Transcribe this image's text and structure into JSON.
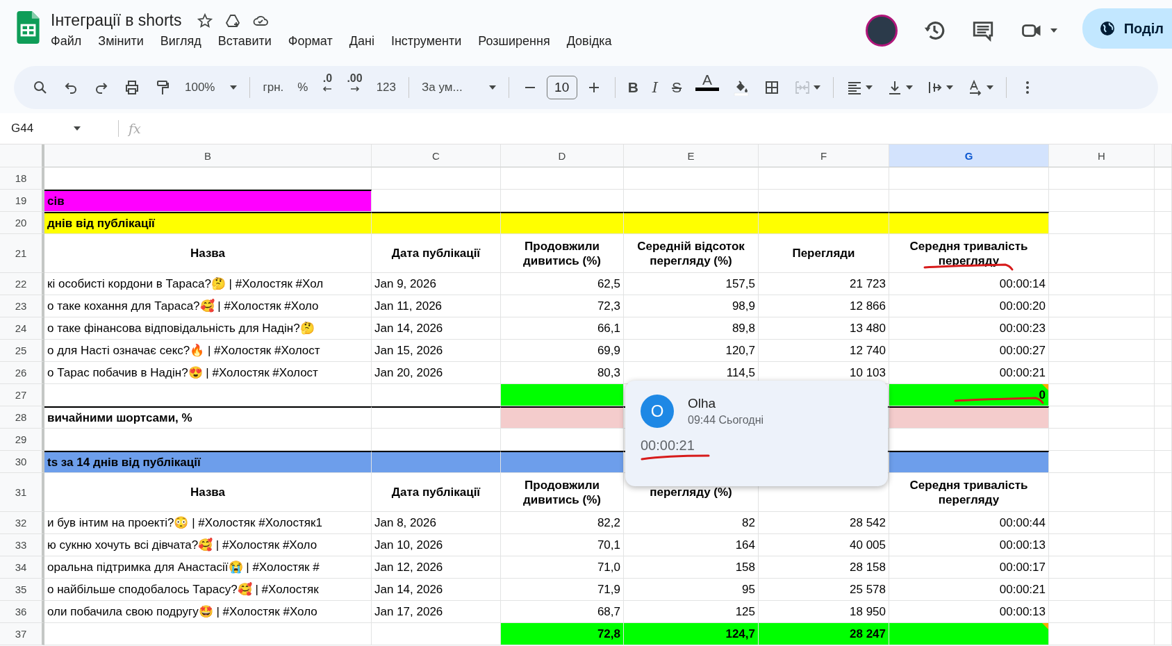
{
  "app": {
    "title": "Інтеграції в shorts",
    "menu": [
      "Файл",
      "Змінити",
      "Вигляд",
      "Вставити",
      "Формат",
      "Дані",
      "Інструменти",
      "Розширення",
      "Довідка"
    ],
    "share_label": "Поділ"
  },
  "toolbar": [
    {
      "kind": "search",
      "disabled": false
    },
    {
      "kind": "undo",
      "disabled": false
    },
    {
      "kind": "redo",
      "disabled": false
    },
    {
      "kind": "print",
      "disabled": false
    },
    {
      "kind": "roller",
      "disabled": false
    },
    {
      "kind": "dropdown",
      "label": "100%"
    },
    {
      "kind": "separator"
    },
    {
      "kind": "label",
      "label": "грн."
    },
    {
      "kind": "label",
      "label": "%"
    },
    {
      "kind": "decdecrease",
      "label": ".0"
    },
    {
      "kind": "decincrease",
      "label": ".00"
    },
    {
      "kind": "label",
      "label": "123"
    },
    {
      "kind": "separator"
    },
    {
      "kind": "dropdown",
      "label": "За ум..."
    },
    {
      "kind": "separator"
    },
    {
      "kind": "minus",
      "disabled": false
    },
    {
      "kind": "field",
      "label": "10"
    },
    {
      "kind": "plus",
      "disabled": false
    },
    {
      "kind": "separator"
    },
    {
      "kind": "bold",
      "label": "B"
    },
    {
      "kind": "italic",
      "label": "I"
    },
    {
      "kind": "strike",
      "label": "S"
    },
    {
      "kind": "textcolor",
      "label": "A"
    },
    {
      "kind": "bucket",
      "disabled": false
    },
    {
      "kind": "borders",
      "disabled": false
    },
    {
      "kind": "merge",
      "disabled": true
    },
    {
      "kind": "separator"
    },
    {
      "kind": "align",
      "disabled": false
    },
    {
      "kind": "valign",
      "disabled": false
    },
    {
      "kind": "wrap",
      "disabled": false
    },
    {
      "kind": "rotate",
      "disabled": false
    },
    {
      "kind": "separator"
    },
    {
      "kind": "more",
      "disabled": false
    }
  ],
  "formula_bar": {
    "name_box": "G44",
    "fx": "fx"
  },
  "columns": [
    {
      "label": "B",
      "selected": false
    },
    {
      "label": "C",
      "selected": false
    },
    {
      "label": "D",
      "selected": false
    },
    {
      "label": "E",
      "selected": false
    },
    {
      "label": "F",
      "selected": false
    },
    {
      "label": "G",
      "selected": true
    },
    {
      "label": "H",
      "selected": false
    }
  ],
  "rows": [
    {
      "number": "18",
      "kind": "data",
      "cells": [
        {},
        {},
        {},
        {},
        {},
        {},
        {}
      ]
    },
    {
      "number": "19",
      "kind": "section",
      "cells": [
        {
          "text": "сів",
          "color": "#ff00ff"
        },
        {},
        {},
        {},
        {},
        {},
        {}
      ]
    },
    {
      "number": "20",
      "kind": "section",
      "cells": [
        {
          "text": "днів від публікації",
          "color": "#ffff00"
        },
        {
          "color": "#ffff00"
        },
        {
          "color": "#ffff00"
        },
        {
          "color": "#ffff00"
        },
        {
          "color": "#ffff00"
        },
        {
          "color": "#ffff00"
        },
        {}
      ]
    },
    {
      "number": "21",
      "kind": "header",
      "cells": [
        {
          "text": "Назва"
        },
        {
          "text": "Дата публікації"
        },
        {
          "text": "Продовжили дивитись (%)"
        },
        {
          "text": "Середній відсоток перегляду (%)"
        },
        {
          "text": "Перегляди"
        },
        {
          "text": "Середня тривалість перегляду",
          "marked": true
        },
        {}
      ]
    },
    {
      "number": "22",
      "kind": "data",
      "cells": [
        {
          "text": "кі особисті кордони в Тараса?🤔 | #Холостяк #Хол"
        },
        {
          "text": "Jan 9, 2026"
        },
        {
          "text": "62,5"
        },
        {
          "text": "157,5"
        },
        {
          "text": "21 723"
        },
        {
          "text": "00:00:14"
        },
        {}
      ]
    },
    {
      "number": "23",
      "kind": "data",
      "cells": [
        {
          "text": "о таке кохання для Тараса?🥰 | #Холостяк #Холо"
        },
        {
          "text": "Jan 11, 2026"
        },
        {
          "text": "72,3"
        },
        {
          "text": "98,9"
        },
        {
          "text": "12 866"
        },
        {
          "text": "00:00:20"
        },
        {}
      ]
    },
    {
      "number": "24",
      "kind": "data",
      "cells": [
        {
          "text": "о таке фінансова відповідальність для Надін?🤔"
        },
        {
          "text": "Jan 14, 2026"
        },
        {
          "text": "66,1"
        },
        {
          "text": "89,8"
        },
        {
          "text": "13 480"
        },
        {
          "text": "00:00:23"
        },
        {}
      ]
    },
    {
      "number": "25",
      "kind": "data",
      "cells": [
        {
          "text": "о для Насті означає секс?🔥 | #Холостяк #Холост"
        },
        {
          "text": "Jan 15, 2026"
        },
        {
          "text": "69,9"
        },
        {
          "text": "120,7"
        },
        {
          "text": "12 740"
        },
        {
          "text": "00:00:27"
        },
        {}
      ]
    },
    {
      "number": "26",
      "kind": "data",
      "cells": [
        {
          "text": "о Тарас побачив в Надін?😍 | #Холостяк #Холост"
        },
        {
          "text": "Jan 20, 2026"
        },
        {
          "text": "80,3"
        },
        {
          "text": "114,5"
        },
        {
          "text": "10 103"
        },
        {
          "text": "00:00:21"
        },
        {}
      ]
    },
    {
      "number": "27",
      "kind": "total",
      "cells": [
        {},
        {},
        {
          "color": "#00ff00"
        },
        {},
        {},
        {
          "text": "0",
          "color": "#00ff00",
          "comment": true,
          "marked": true
        },
        {}
      ]
    },
    {
      "number": "28",
      "kind": "section",
      "cells": [
        {
          "text": "вичайними шортсами, %"
        },
        {},
        {
          "color": "#f4cccc"
        },
        {},
        {},
        {
          "color": "#f4cccc"
        },
        {}
      ]
    },
    {
      "number": "29",
      "kind": "data",
      "cells": [
        {},
        {},
        {},
        {},
        {},
        {},
        {}
      ]
    },
    {
      "number": "30",
      "kind": "section",
      "cells": [
        {
          "text": "ts за 14 днів від публікації",
          "color": "#6d9eeb"
        },
        {
          "color": "#6d9eeb"
        },
        {
          "color": "#6d9eeb"
        },
        {},
        {},
        {
          "color": "#6d9eeb"
        },
        {}
      ]
    },
    {
      "number": "31",
      "kind": "header",
      "cells": [
        {
          "text": "Назва"
        },
        {
          "text": "Дата публікації"
        },
        {
          "text": "Продовжили дивитись (%)"
        },
        {
          "text": "перегляду (%)"
        },
        {},
        {
          "text": "Середня тривалість перегляду"
        },
        {}
      ]
    },
    {
      "number": "32",
      "kind": "data",
      "cells": [
        {
          "text": "и був інтим на проекті?😳 | #Холостяк #Холостяк1"
        },
        {
          "text": "Jan 8, 2026"
        },
        {
          "text": "82,2"
        },
        {
          "text": "82"
        },
        {
          "text": "28 542"
        },
        {
          "text": "00:00:44"
        },
        {}
      ]
    },
    {
      "number": "33",
      "kind": "data",
      "cells": [
        {
          "text": "ю сукню хочуть всі дівчата?🥰 | #Холостяк #Холо"
        },
        {
          "text": "Jan 10, 2026"
        },
        {
          "text": "70,1"
        },
        {
          "text": "164"
        },
        {
          "text": "40 005"
        },
        {
          "text": "00:00:13"
        },
        {}
      ]
    },
    {
      "number": "34",
      "kind": "data",
      "cells": [
        {
          "text": "оральна підтримка для Анастасії😭 | #Холостяк #"
        },
        {
          "text": "Jan 12, 2026"
        },
        {
          "text": "71,0"
        },
        {
          "text": "158"
        },
        {
          "text": "28 158"
        },
        {
          "text": "00:00:17"
        },
        {}
      ]
    },
    {
      "number": "35",
      "kind": "data",
      "cells": [
        {
          "text": "о найбільше сподобалось Тарасу?🥰 | #Холостяк"
        },
        {
          "text": "Jan 14, 2026"
        },
        {
          "text": "71,9"
        },
        {
          "text": "95"
        },
        {
          "text": "25 578"
        },
        {
          "text": "00:00:21"
        },
        {}
      ]
    },
    {
      "number": "36",
      "kind": "data",
      "cells": [
        {
          "text": "оли побачила свою подругу🤩 | #Холостяк #Холо"
        },
        {
          "text": "Jan 17, 2026"
        },
        {
          "text": "68,7"
        },
        {
          "text": "125"
        },
        {
          "text": "18 950"
        },
        {
          "text": "00:00:13"
        },
        {}
      ]
    },
    {
      "number": "37",
      "kind": "total",
      "cells": [
        {},
        {},
        {
          "text": "72,8",
          "color": "#00ff00"
        },
        {
          "text": "124,7",
          "color": "#00ff00"
        },
        {
          "text": "28 247",
          "color": "#00ff00"
        },
        {
          "color": "#00ff00",
          "comment": true
        },
        {}
      ]
    }
  ],
  "comment": {
    "initial": "O",
    "author": "Olha",
    "time": "09:44 Сьогодні",
    "text": "00:00:21",
    "marked": true
  }
}
